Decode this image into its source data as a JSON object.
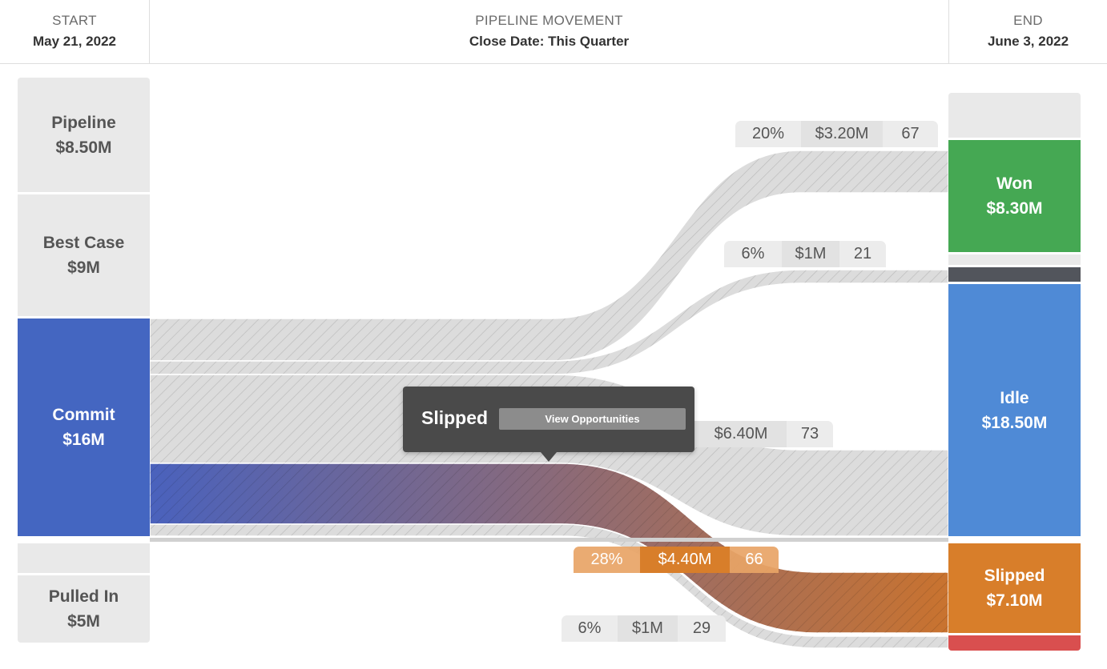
{
  "header": {
    "start": {
      "label": "START",
      "date": "May 21, 2022"
    },
    "middle": {
      "label": "PIPELINE MOVEMENT",
      "subtitle": "Close Date: This Quarter"
    },
    "end": {
      "label": "END",
      "date": "June 3, 2022"
    }
  },
  "start_nodes": [
    {
      "name": "Pipeline",
      "value": "$8.50M"
    },
    {
      "name": "Best Case",
      "value": "$9M"
    },
    {
      "name": "Commit",
      "value": "$16M",
      "color": "#4466c1"
    },
    {
      "name": "Pulled In",
      "value": "$5M"
    }
  ],
  "end_nodes": [
    {
      "name": "Won",
      "value": "$8.30M",
      "color": "#45a853"
    },
    {
      "name": "Idle",
      "value": "$18.50M",
      "color": "#4f8ad6"
    },
    {
      "name": "Slipped",
      "value": "$7.10M",
      "color": "#d87e2a"
    }
  ],
  "flow_labels": [
    {
      "pct": "20%",
      "amount": "$3.20M",
      "count": "67"
    },
    {
      "pct": "6%",
      "amount": "$1M",
      "count": "21"
    },
    {
      "amount": "$6.40M",
      "count": "73"
    },
    {
      "pct": "28%",
      "amount": "$4.40M",
      "count": "66"
    },
    {
      "pct": "6%",
      "amount": "$1M",
      "count": "29"
    }
  ],
  "tooltip": {
    "title": "Slipped",
    "button": "View Opportunities"
  },
  "colors": {
    "lost": "#52555c",
    "red": "#d94f4f",
    "hatch_fill": "#dcdcdc",
    "slipped_label": "#e8a466"
  },
  "chart_data": {
    "type": "sankey",
    "nodes_start": [
      "Pipeline $8.50M",
      "Best Case $9M",
      "Commit $16M",
      "Pulled In $5M"
    ],
    "nodes_end": [
      "Won $8.30M",
      "Idle $18.50M",
      "Slipped $7.10M"
    ],
    "flows": [
      {
        "from": "Commit",
        "to": "Won",
        "pct": "20%",
        "amount": "$3.20M",
        "count": 67
      },
      {
        "from": "Commit",
        "to": "(dark segment)",
        "pct": "6%",
        "amount": "$1M",
        "count": 21
      },
      {
        "from": "Commit",
        "to": "Idle",
        "amount": "$6.40M",
        "count": 73
      },
      {
        "from": "Commit",
        "to": "Slipped",
        "pct": "28%",
        "amount": "$4.40M",
        "count": 66
      },
      {
        "from": "Commit",
        "to": "(red segment)",
        "pct": "6%",
        "amount": "$1M",
        "count": 29
      }
    ]
  }
}
